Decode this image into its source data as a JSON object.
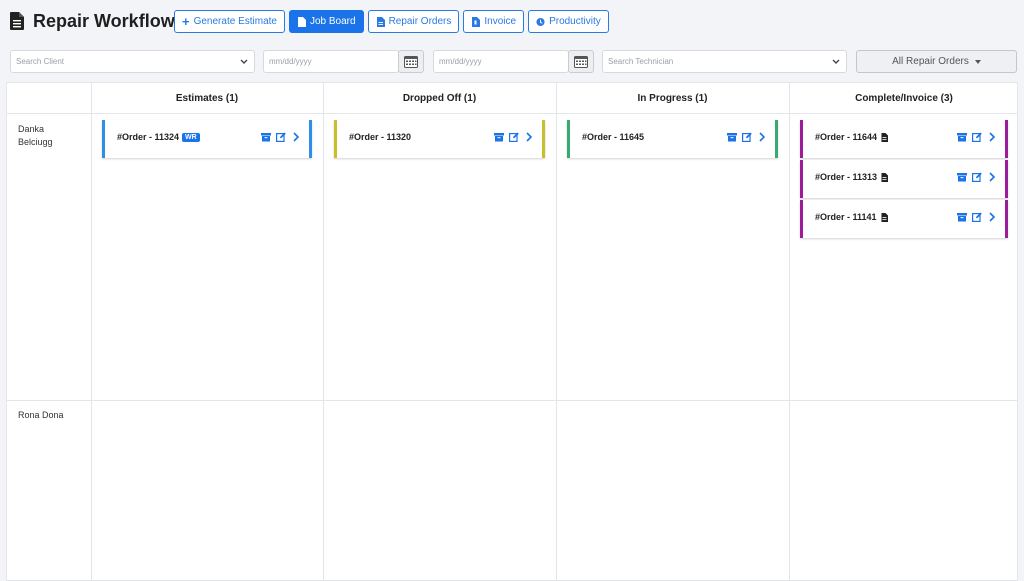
{
  "header": {
    "title": "Repair Workflow"
  },
  "nav": [
    {
      "label": "Generate Estimate",
      "icon": "plus-icon",
      "active": false
    },
    {
      "label": "Job Board",
      "icon": "document-icon",
      "active": true
    },
    {
      "label": "Repair Orders",
      "icon": "document-icon",
      "active": false
    },
    {
      "label": "Invoice",
      "icon": "invoice-icon",
      "active": false
    },
    {
      "label": "Productivity",
      "icon": "clock-icon",
      "active": false
    }
  ],
  "filters": {
    "client_placeholder": "Search Client",
    "date_from_placeholder": "mm/dd/yyyy",
    "date_to_placeholder": "mm/dd/yyyy",
    "technician_placeholder": "Search Technician",
    "repair_orders_label": "All Repair Orders"
  },
  "columns": [
    {
      "label": "Estimates (1)",
      "color": "#2f8fe8"
    },
    {
      "label": "Dropped Off (1)",
      "color": "#c9bf2a"
    },
    {
      "label": "In Progress (1)",
      "color": "#3aa872"
    },
    {
      "label": "Complete/Invoice (3)",
      "color": "#9b1c9b"
    }
  ],
  "technicians": [
    {
      "name": "Danka Belciugg",
      "orders": [
        [
          {
            "label": "#Order - 11324",
            "badge": "WR"
          }
        ],
        [
          {
            "label": "#Order - 11320"
          }
        ],
        [
          {
            "label": "#Order - 11645"
          }
        ],
        [
          {
            "label": "#Order - 11644",
            "doc": true
          },
          {
            "label": "#Order - 11313",
            "doc": true
          },
          {
            "label": "#Order - 11141",
            "doc": true
          }
        ]
      ]
    },
    {
      "name": "Rona Dona",
      "orders": [
        [],
        [],
        [],
        []
      ]
    }
  ],
  "colors": {
    "primary": "#1a73e8",
    "border": "#e3e5e8",
    "background": "#f2f4f8"
  }
}
